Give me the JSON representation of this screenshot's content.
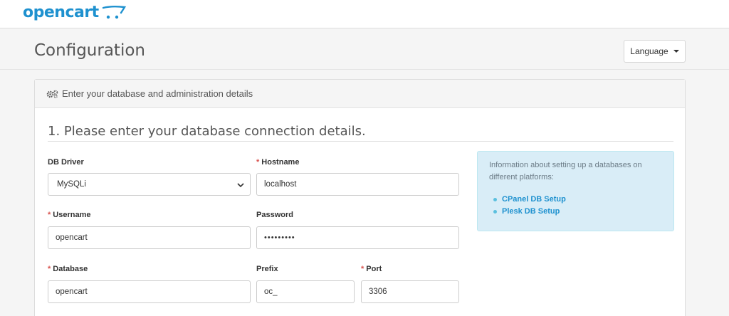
{
  "brand": {
    "name": "opencart"
  },
  "header": {
    "title": "Configuration",
    "language_label": "Language"
  },
  "panel": {
    "heading": "Enter your database and administration details",
    "section_title": "1. Please enter your database connection details."
  },
  "form": {
    "db_driver": {
      "label": "DB Driver",
      "value": "MySQLi",
      "required": false
    },
    "hostname": {
      "label": "Hostname",
      "value": "localhost",
      "required": true
    },
    "username": {
      "label": "Username",
      "value": "opencart",
      "required": true
    },
    "password": {
      "label": "Password",
      "masked_value": "•••••••••",
      "required": false
    },
    "database": {
      "label": "Database",
      "value": "opencart",
      "required": true
    },
    "prefix": {
      "label": "Prefix",
      "value": "oc_",
      "required": false
    },
    "port": {
      "label": "Port",
      "value": "3306",
      "required": true
    },
    "required_marker": "*"
  },
  "info": {
    "text": "Information about setting up a databases on different platforms:",
    "links": [
      {
        "label": "CPanel DB Setup"
      },
      {
        "label": "Plesk DB Setup"
      }
    ]
  },
  "colors": {
    "brand": "#1e91cf",
    "required": "#d9534f",
    "info_bg": "#d9edf7"
  }
}
